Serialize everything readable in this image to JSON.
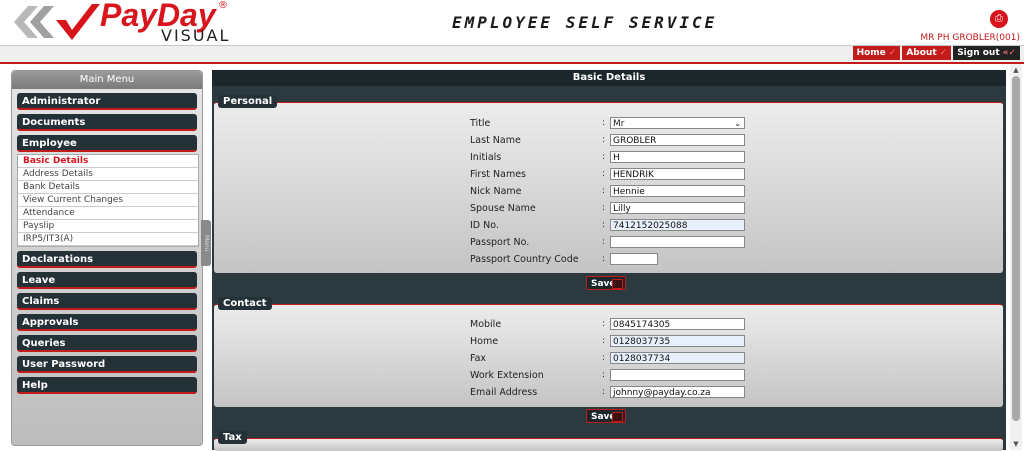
{
  "header": {
    "logo_text": "PayDay",
    "logo_sub": "VISUAL",
    "logo_mark": "®",
    "title": "EMPLOYEE SELF SERVICE",
    "user": "MR PH GROBLER(001)",
    "print_icon": "printer-icon"
  },
  "nav": {
    "home": "Home",
    "about": "About",
    "signout": "Sign out"
  },
  "sidebar": {
    "title": "Main Menu",
    "menu_tab": "Menu",
    "items": [
      "Administrator",
      "Documents",
      "Employee",
      "Declarations",
      "Leave",
      "Claims",
      "Approvals",
      "Queries",
      "User Password",
      "Help"
    ],
    "submenu": [
      "Basic Details",
      "Address Details",
      "Bank Details",
      "View Current Changes",
      "Attendance",
      "Payslip",
      "IRP5/IT3(A)"
    ],
    "active_submenu": "Basic Details"
  },
  "main": {
    "title": "Basic Details",
    "save_label": "Save",
    "personal": {
      "legend": "Personal",
      "fields": [
        {
          "label": "Title",
          "value": "Mr"
        },
        {
          "label": "Last Name",
          "value": "GROBLER"
        },
        {
          "label": "Initials",
          "value": "H"
        },
        {
          "label": "First Names",
          "value": "HENDRIK"
        },
        {
          "label": "Nick Name",
          "value": "Hennie"
        },
        {
          "label": "Spouse Name",
          "value": "Lilly"
        },
        {
          "label": "ID No.",
          "value": "7412152025088"
        },
        {
          "label": "Passport No.",
          "value": ""
        },
        {
          "label": "Passport Country Code",
          "value": ""
        }
      ]
    },
    "contact": {
      "legend": "Contact",
      "fields": [
        {
          "label": "Mobile",
          "value": "0845174305"
        },
        {
          "label": "Home",
          "value": "0128037735"
        },
        {
          "label": "Fax",
          "value": "0128037734"
        },
        {
          "label": "Work Extension",
          "value": ""
        },
        {
          "label": "Email Address",
          "value": "johnny@payday.co.za"
        }
      ]
    },
    "tax": {
      "legend": "Tax"
    }
  },
  "colors": {
    "brand_red": "#d8141d",
    "dark": "#243238"
  }
}
